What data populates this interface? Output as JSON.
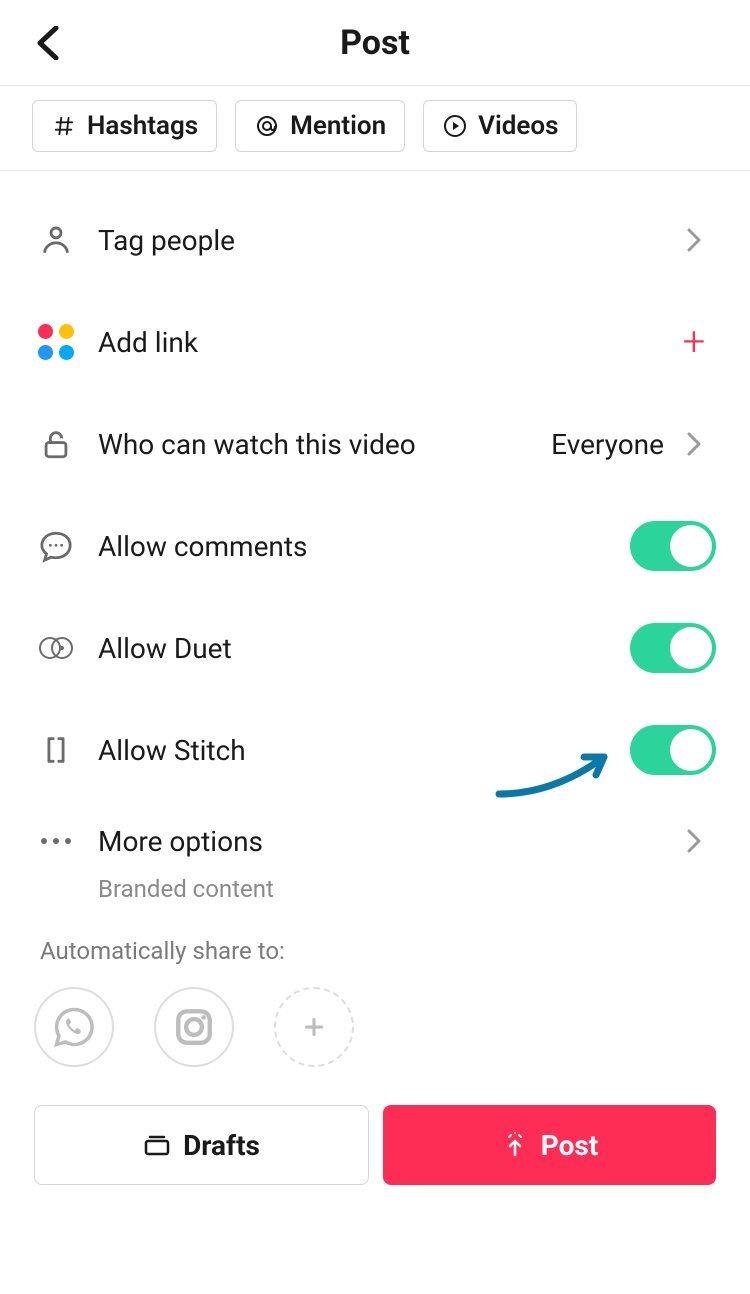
{
  "header": {
    "title": "Post"
  },
  "chips": {
    "hashtags": "Hashtags",
    "mention": "Mention",
    "videos": "Videos"
  },
  "rows": {
    "tag_people": "Tag people",
    "add_link": "Add link",
    "privacy_label": "Who can watch this video",
    "privacy_value": "Everyone",
    "allow_comments": "Allow comments",
    "allow_duet": "Allow Duet",
    "allow_stitch": "Allow Stitch",
    "more_options": "More options",
    "more_options_sub": "Branded content"
  },
  "share": {
    "title": "Automatically share to:"
  },
  "footer": {
    "drafts": "Drafts",
    "post": "Post"
  }
}
